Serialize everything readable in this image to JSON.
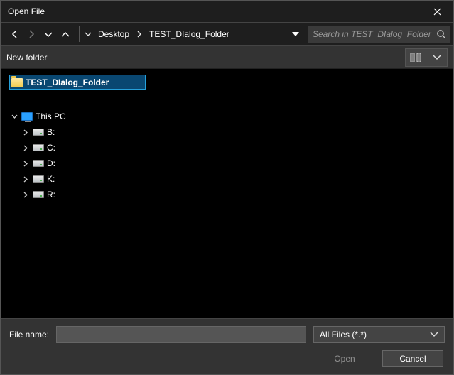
{
  "title": "Open File",
  "nav": {
    "back_enabled": true,
    "forward_enabled": false
  },
  "breadcrumb": {
    "segments": [
      "Desktop",
      "TEST_DIalog_Folder"
    ]
  },
  "search": {
    "placeholder": "Search in TEST_DIalog_Folder"
  },
  "toolbar": {
    "new_folder_label": "New folder"
  },
  "tree": {
    "selected_folder": "TEST_DIalog_Folder",
    "this_pc_label": "This PC",
    "drives": [
      {
        "label": "B:"
      },
      {
        "label": "C:"
      },
      {
        "label": "D:"
      },
      {
        "label": "K:"
      },
      {
        "label": "R:"
      }
    ]
  },
  "bottom": {
    "file_name_label": "File name:",
    "file_name_value": "",
    "filter_label": "All Files (*.*)",
    "open_label": "Open",
    "cancel_label": "Cancel"
  }
}
